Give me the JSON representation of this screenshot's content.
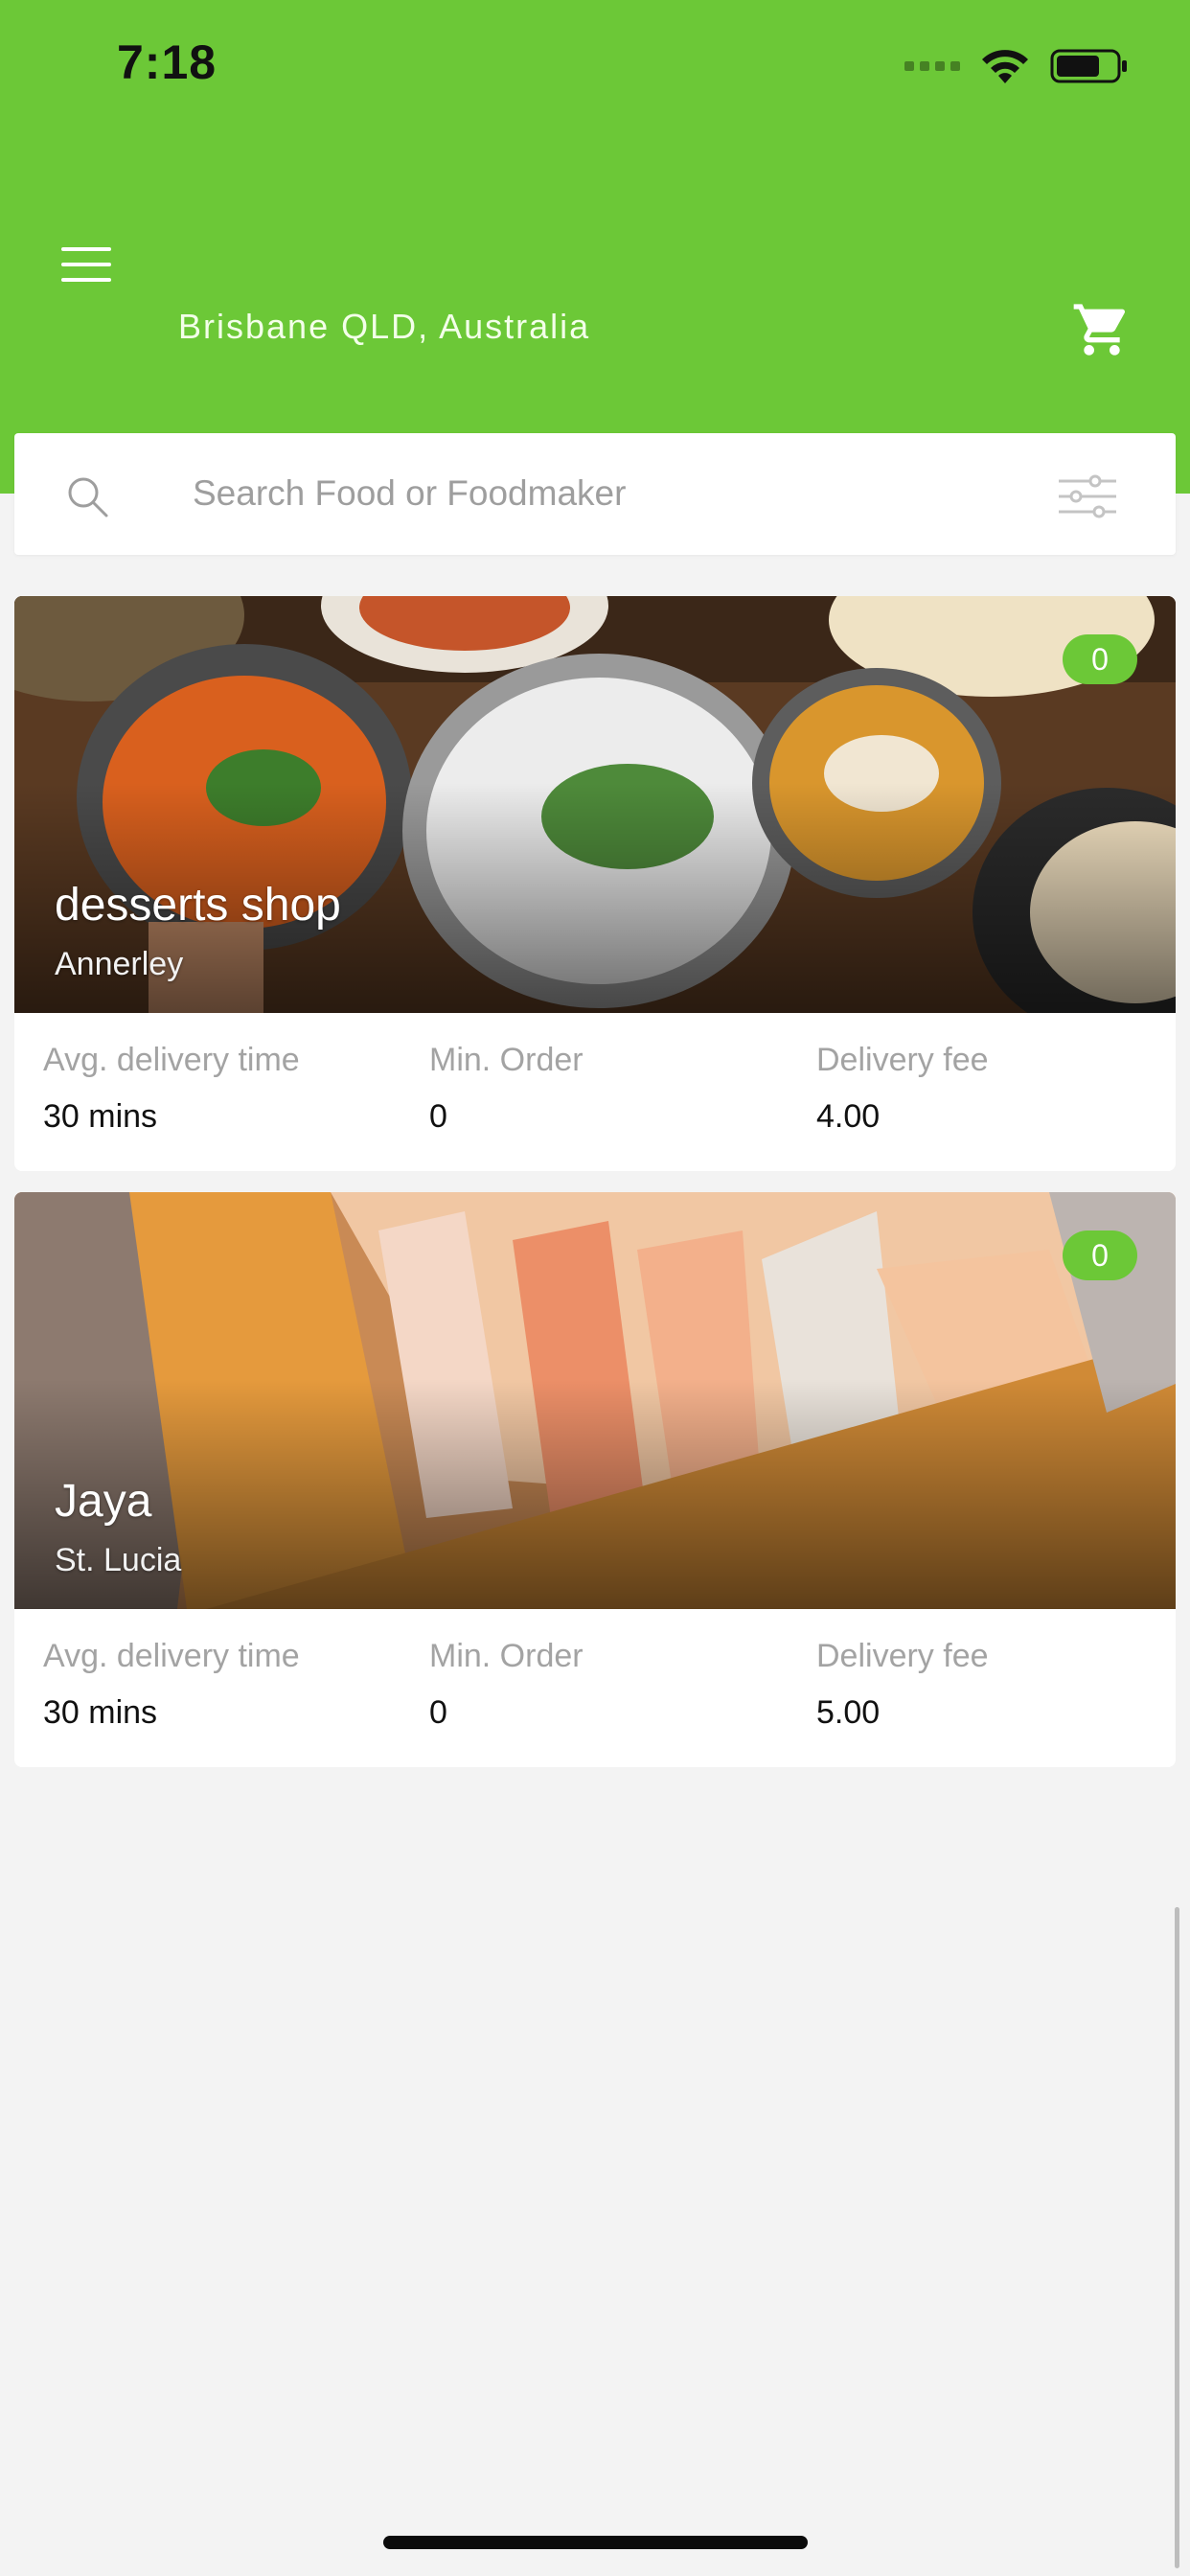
{
  "status_bar": {
    "time": "7:18"
  },
  "header": {
    "location": "Brisbane QLD, Australia",
    "brand_color": "#6cc837"
  },
  "search": {
    "placeholder": "Search Food or Foodmaker",
    "value": ""
  },
  "shops": [
    {
      "name": "desserts shop",
      "suburb": "Annerley",
      "badge": "0",
      "avg_delivery_label": "Avg. delivery time",
      "avg_delivery_value": "30 mins",
      "min_order_label": "Min. Order",
      "min_order_value": "0",
      "delivery_fee_label": "Delivery fee",
      "delivery_fee_value": "4.00"
    },
    {
      "name": "Jaya",
      "suburb": "St. Lucia",
      "badge": "0",
      "avg_delivery_label": "Avg. delivery time",
      "avg_delivery_value": "30 mins",
      "min_order_label": "Min. Order",
      "min_order_value": "0",
      "delivery_fee_label": "Delivery fee",
      "delivery_fee_value": "5.00"
    }
  ],
  "icons": {
    "menu": "hamburger-icon",
    "cart": "cart-icon",
    "search": "search-icon",
    "filter": "filter-sliders-icon",
    "wifi": "wifi-icon",
    "battery": "battery-icon"
  }
}
